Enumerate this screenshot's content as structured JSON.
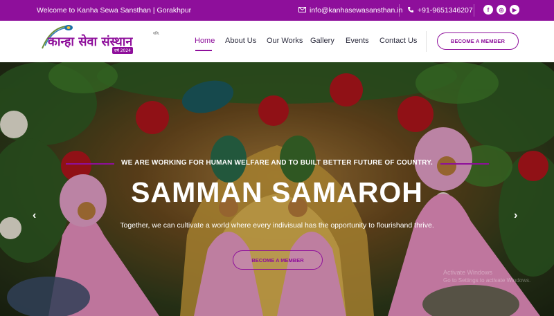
{
  "topbar": {
    "welcome": "Welcome to Kanha Sewa Sansthan | Gorakhpur",
    "email": "info@kanhasewasansthan.in",
    "phone": "+91-9651346207",
    "social": [
      {
        "name": "facebook-icon",
        "glyph": "f"
      },
      {
        "name": "instagram-icon",
        "glyph": "◎"
      },
      {
        "name": "youtube-icon",
        "glyph": "▶"
      }
    ]
  },
  "logo": {
    "text": "कान्हा सेवा संस्थान",
    "tag": "पंजि.",
    "year": "वर्ष 2024"
  },
  "nav": {
    "items": [
      "Home",
      "About Us",
      "Our Works",
      "Gallery",
      "Events",
      "Contact Us"
    ],
    "active": "Home",
    "cta": "BECOME A MEMBER"
  },
  "hero": {
    "kicker": "WE ARE WORKING FOR HUMAN WELFARE AND TO BUILT BETTER FUTURE OF COUNTRY.",
    "title": "SAMMAN SAMAROH",
    "subtitle": "Together, we can cultivate a world where every indivisual has the opportunity to flourishand thrive.",
    "cta": "BECOME A MEMBER",
    "prev": "‹",
    "next": "›",
    "watermark_line1": "Activate Windows",
    "watermark_line2": "Go to Settings to activate Windows."
  },
  "colors": {
    "brand": "#8e0f9b",
    "text": "#2b2b3d"
  }
}
